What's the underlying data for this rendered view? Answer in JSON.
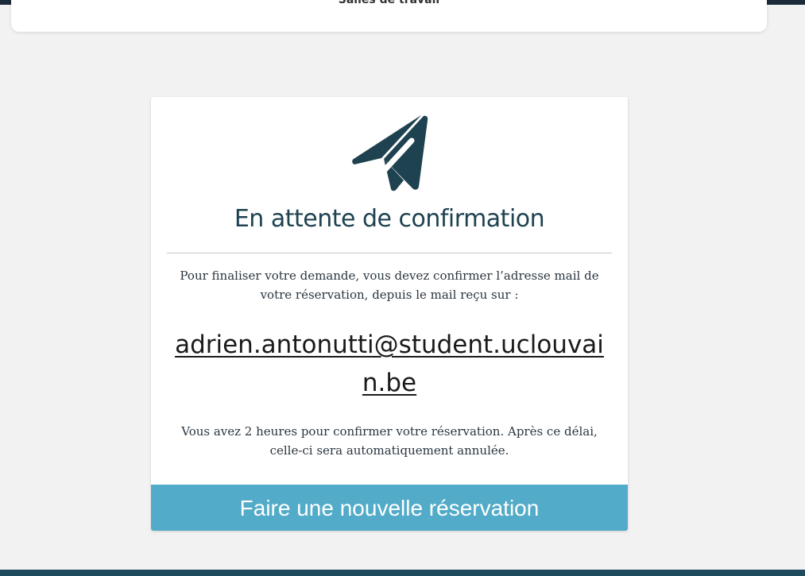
{
  "header": {
    "partial_text": "Salles de travail"
  },
  "confirmation": {
    "icon": "paper-plane-icon",
    "title": "En attente de confirmation",
    "instructions": "Pour finaliser votre demande, vous devez confirmer l’adresse mail de votre réservation, depuis le mail reçu sur :",
    "email": "adrien.antonutti@student.uclouvain.be",
    "delay_notice": "Vous avez 2 heures pour confirmer votre réservation. Après ce délai, celle-ci sera automatiquement annulée.",
    "new_reservation_label": "Faire une nouvelle réservation"
  },
  "colors": {
    "accent": "#52abc8",
    "title": "#1e4250",
    "background": "#f2f2f2",
    "footer": "#1e4a5e"
  }
}
